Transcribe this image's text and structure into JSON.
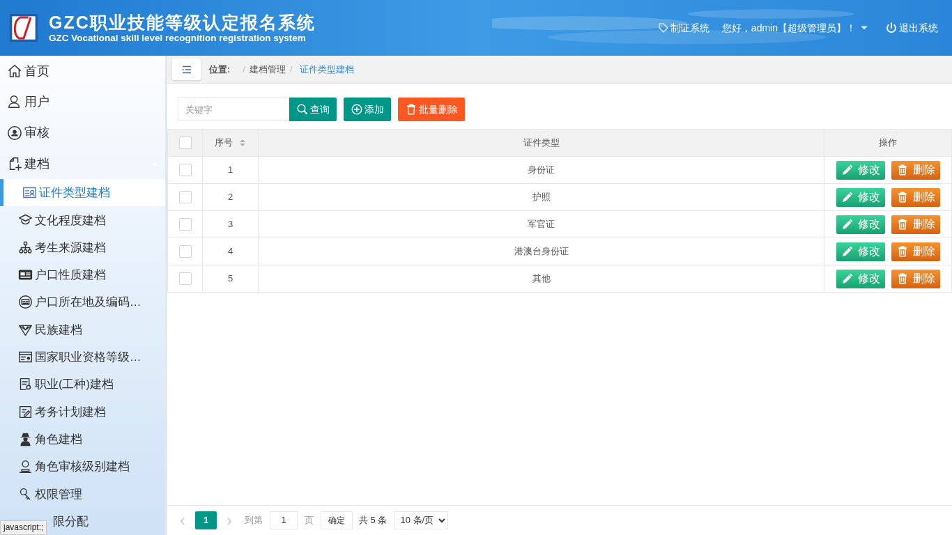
{
  "header": {
    "title": "GZC职业技能等级认定报名系统",
    "subtitle": "GZC Vocational skill level recognition registration system",
    "links": [
      {
        "kind": "tag",
        "label": "制证系统"
      },
      {
        "kind": "user",
        "label": "您好，admin【超级管理员】！"
      },
      {
        "kind": "power",
        "label": "退出系统"
      }
    ]
  },
  "sidebar": {
    "items": [
      {
        "label": "首页",
        "selected": false
      },
      {
        "label": "用户",
        "selected": false
      },
      {
        "label": "审核",
        "selected": false
      },
      {
        "label": "建档",
        "selected": false,
        "expanded": true,
        "children": [
          {
            "label": "证件类型建档",
            "selected": true
          },
          {
            "label": "文化程度建档",
            "selected": false
          },
          {
            "label": "考生来源建档",
            "selected": false
          },
          {
            "label": "户口性质建档",
            "selected": false
          },
          {
            "label": "户口所在地及编码…",
            "selected": false
          },
          {
            "label": "民族建档",
            "selected": false
          },
          {
            "label": "国家职业资格等级…",
            "selected": false
          },
          {
            "label": "职业(工种)建档",
            "selected": false
          },
          {
            "label": "考务计划建档",
            "selected": false
          },
          {
            "label": "角色建档",
            "selected": false
          },
          {
            "label": "角色审核级别建档",
            "selected": false
          },
          {
            "label": "权限管理",
            "selected": false
          },
          {
            "label": "限分配",
            "selected": false
          }
        ]
      }
    ]
  },
  "status_tooltip": "javascript:;",
  "breadcrumb": {
    "label": "位置:",
    "items": [
      {
        "separator": "/",
        "label": "建档管理",
        "selected": false
      },
      {
        "separator": "/",
        "label": "证件类型建档",
        "selected": true
      }
    ]
  },
  "toolbar": {
    "search": {
      "placeholder": "关键字"
    },
    "buttons": [
      {
        "kind": "search",
        "label": "查询"
      },
      {
        "kind": "add",
        "label": "添加"
      },
      {
        "kind": "delete",
        "label": "批量删除"
      }
    ]
  },
  "table": {
    "select_all_checked": false,
    "columns": [
      "序号",
      "证件类型",
      "操作"
    ],
    "rows": [
      {
        "checked": false,
        "no": "1",
        "type": "身份证",
        "actions": [
          "修改",
          "删除"
        ]
      },
      {
        "checked": false,
        "no": "2",
        "type": "护照",
        "actions": [
          "修改",
          "删除"
        ]
      },
      {
        "checked": false,
        "no": "3",
        "type": "军官证",
        "actions": [
          "修改",
          "删除"
        ]
      },
      {
        "checked": false,
        "no": "4",
        "type": "港澳台身份证",
        "actions": [
          "修改",
          "删除"
        ]
      },
      {
        "checked": false,
        "no": "5",
        "type": "其他",
        "actions": [
          "修改",
          "删除"
        ]
      }
    ]
  },
  "pagination": {
    "prev": "‹",
    "pages": [
      {
        "label": "1",
        "selected": true
      }
    ],
    "next": "›",
    "goto_label": "到第",
    "goto_value": "1",
    "page_unit": "页",
    "confirm": "确定",
    "total": "共 5 条",
    "page_size": "10 条/页"
  }
}
